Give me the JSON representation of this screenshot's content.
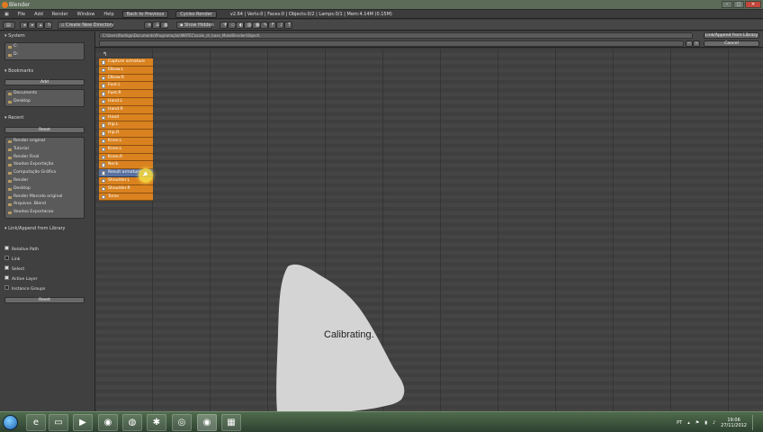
{
  "window": {
    "title": "Blender"
  },
  "menu": {
    "items": [
      "File",
      "Add",
      "Render",
      "Window",
      "Help"
    ],
    "back_button": "Back to Previous",
    "engine": "Cycles Render",
    "stats": "v2.64 | Verts:0 | Faces:0 | Objects:0/2 | Lamps:0/1 | Mem:4.14M (0.15M)"
  },
  "toolbar": {
    "create_dir": "Create New Directory",
    "show_hidden": "Show Hidden"
  },
  "path": {
    "directory": "C:\\Users\\Rodrigo\\Documents\\Programação\\IMATEC\\scale_dr_base_MakeBlender\\Object\\",
    "filename": "",
    "link_button": "Link/Append from Library",
    "cancel_button": "Cancel"
  },
  "sidebar": {
    "system": {
      "header": "System",
      "items": [
        "C:",
        "D:"
      ]
    },
    "bookmarks": {
      "header": "Bookmarks",
      "add": "Add",
      "items": [
        "Documents",
        "Desktop"
      ]
    },
    "recent": {
      "header": "Recent",
      "reset": "Reset",
      "items": [
        "Render original",
        "Tutorial",
        "Render Final",
        "Voodoo Exportação",
        "Computação Gráfica",
        "Render",
        "Desktop",
        "Render Marcelo original",
        "Arquivos .Blend",
        "Voodoo Exportacao"
      ]
    },
    "link_append": {
      "header": "Link/Append from Library",
      "options": [
        {
          "label": "Relative Path",
          "checked": true
        },
        {
          "label": "Link",
          "checked": false
        },
        {
          "label": "Select",
          "checked": true
        },
        {
          "label": "Active Layer",
          "checked": true
        },
        {
          "label": "Instance Groups",
          "checked": false
        }
      ],
      "reset": "Reset"
    }
  },
  "files": {
    "parent_icon": "↰",
    "items": [
      "Capture armature",
      "Elbow.L",
      "Elbow.R",
      "Foot.L",
      "Foot.R",
      "Hand.L",
      "Hand.R",
      "Head",
      "Hip.L",
      "Hip.R",
      "Knee.L",
      "Knee.L",
      "Knee.R",
      "Neck",
      "Result armature",
      "Shoulder.L",
      "Shoulder.R",
      "Torso"
    ],
    "selected_index": 14
  },
  "overlay": {
    "calibrating": "Calibrating."
  },
  "taskbar": {
    "language": "PT",
    "time": "19:06",
    "date": "27/11/2012"
  },
  "colors": {
    "file_orange": "#d9821f",
    "selected_blue": "#5a72a0",
    "cursor_highlight": "#f0d640"
  }
}
